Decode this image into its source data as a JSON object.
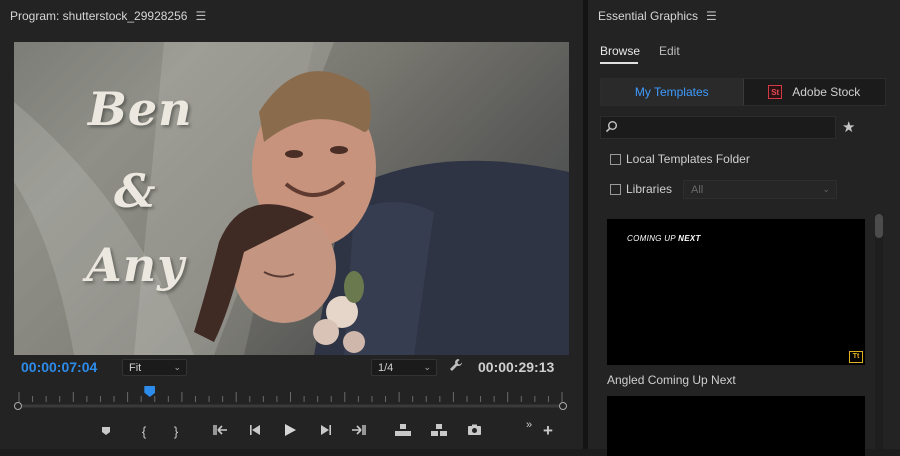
{
  "program": {
    "title": "Program: shutterstock_29928256",
    "title_words": [
      "Ben",
      "&",
      "Any"
    ],
    "current_time": "00:00:07:04",
    "duration": "00:00:29:13",
    "zoom_select": "Fit",
    "resolution_select": "1/4",
    "playhead_fraction": 0.24,
    "transport_icons": [
      "marker-icon",
      "mark-in-icon",
      "mark-out-icon",
      "go-to-in-icon",
      "step-back-icon",
      "play-icon",
      "step-forward-icon",
      "go-to-out-icon",
      "lift-icon",
      "extract-icon",
      "export-frame-icon",
      "overflow-icon",
      "add-button-icon"
    ]
  },
  "essential_graphics": {
    "title": "Essential Graphics",
    "tabs": [
      "Browse",
      "Edit"
    ],
    "active_tab": "Browse",
    "sources": {
      "my_templates": "My Templates",
      "adobe_stock": "Adobe Stock",
      "stock_badge": "St"
    },
    "search": {
      "value": "",
      "placeholder": ""
    },
    "local_templates_label": "Local Templates Folder",
    "libraries_label": "Libraries",
    "libraries_select": "All",
    "templates": [
      {
        "name": "Angled Coming Up Next",
        "thumb_text_a": "COMING UP",
        "thumb_text_b": "NEXT"
      }
    ]
  },
  "colors": {
    "accent": "#2d8ceb",
    "panel_bg": "#232323",
    "mogrt_badge": "#e0b020",
    "stock_badge": "#d33a45"
  }
}
